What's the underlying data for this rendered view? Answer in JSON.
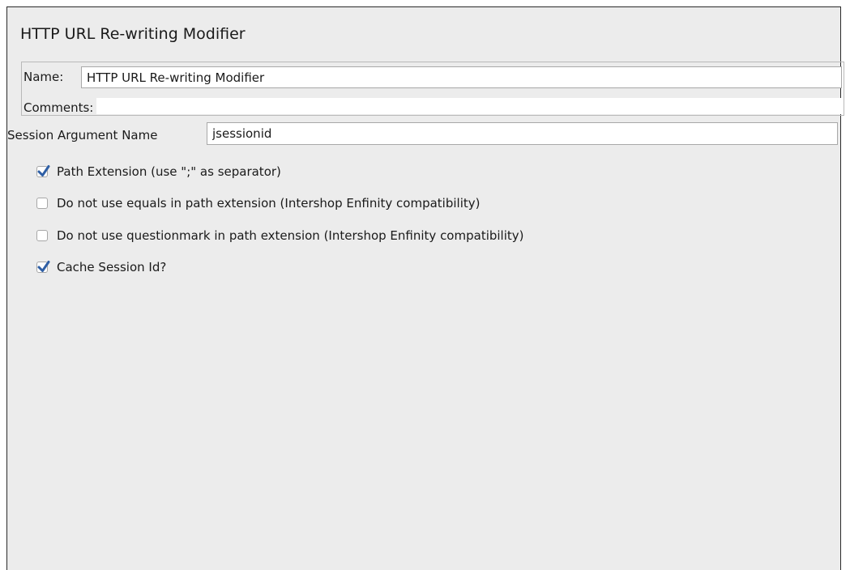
{
  "panel": {
    "title": "HTTP URL Re-writing Modifier"
  },
  "name_field": {
    "label": "Name:",
    "value": "HTTP URL Re-writing Modifier"
  },
  "comments_field": {
    "label": "Comments:",
    "value": ""
  },
  "session_arg": {
    "label": "Session Argument Name",
    "value": "jsessionid"
  },
  "options": [
    {
      "label": "Path Extension (use \";\" as separator)",
      "checked": true
    },
    {
      "label": "Do not use equals in path extension (Intershop Enfinity compatibility)",
      "checked": false
    },
    {
      "label": "Do not use questionmark in path extension (Intershop Enfinity compatibility)",
      "checked": false
    },
    {
      "label": "Cache Session Id?",
      "checked": true
    }
  ],
  "colors": {
    "panel_bg": "#ececec",
    "check_mark": "#2f5fa5"
  }
}
